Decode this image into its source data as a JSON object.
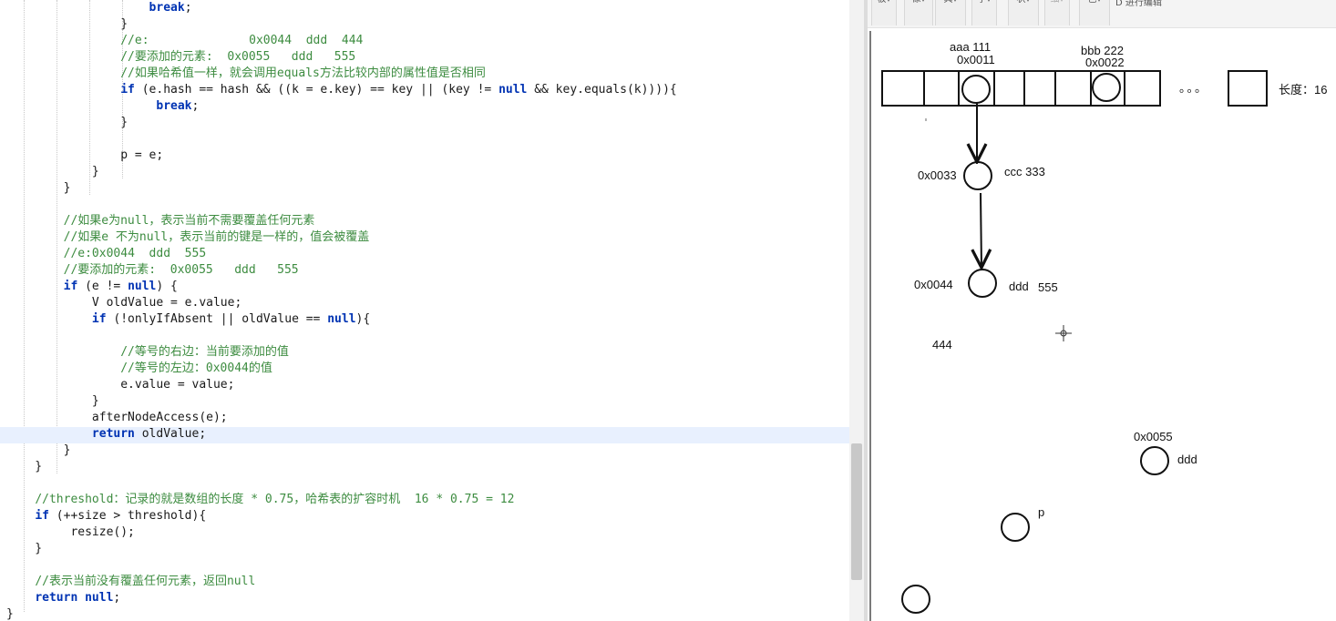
{
  "editor": {
    "lines": [
      "                    break;",
      "                }",
      "                //e:              0x0044  ddd  444",
      "                //要添加的元素:  0x0055   ddd   555",
      "                //如果哈希值一样，就会调用equals方法比较内部的属性值是否相同",
      "                if (e.hash == hash && ((k = e.key) == key || (key != null && key.equals(k)))){",
      "                     break;",
      "                }",
      "",
      "                p = e;",
      "            }",
      "        }",
      "",
      "        //如果e为null，表示当前不需要覆盖任何元素",
      "        //如果e 不为null，表示当前的键是一样的，值会被覆盖",
      "        //e:0x0044  ddd  555",
      "        //要添加的元素:  0x0055   ddd   555",
      "        if (e != null) {",
      "            V oldValue = e.value;",
      "            if (!onlyIfAbsent || oldValue == null){",
      "",
      "                //等号的右边：当前要添加的值",
      "                //等号的左边：0x0044的值",
      "                e.value = value;",
      "            }",
      "            afterNodeAccess(e);",
      "            return oldValue;",
      "        }",
      "    }",
      "",
      "    //threshold：记录的就是数组的长度 * 0.75，哈希表的扩容时机  16 * 0.75 = 12",
      "    if (++size > threshold){",
      "         resize();",
      "    }",
      "",
      "    //表示当前没有覆盖任何元素，返回null",
      "    return null;",
      "}"
    ]
  },
  "board": {
    "toolbar": [
      "板",
      "像",
      "具",
      "字",
      "状",
      "细",
      "色"
    ],
    "toolbar_tail": "D 进行编辑",
    "diagram": {
      "node_aaa_label": "aaa  111",
      "node_aaa_addr": "0x0011",
      "node_bbb_label": "bbb 222",
      "node_bbb_addr": "0x0022",
      "ellipsis": "。。。",
      "length_label": "长度：16",
      "node_ccc_addr": "0x0033",
      "node_ccc_label": "ccc 333",
      "node_ddd_addr": "0x0044",
      "node_ddd_label": "ddd",
      "node_ddd_value": "555",
      "old_value": "444",
      "new_node_addr": "0x0055",
      "new_node_label": "ddd",
      "p_label": "p"
    }
  },
  "colors": {
    "keyword": "#0033b3",
    "comment": "#3d8c40",
    "highlight": "#e8f0fe"
  }
}
